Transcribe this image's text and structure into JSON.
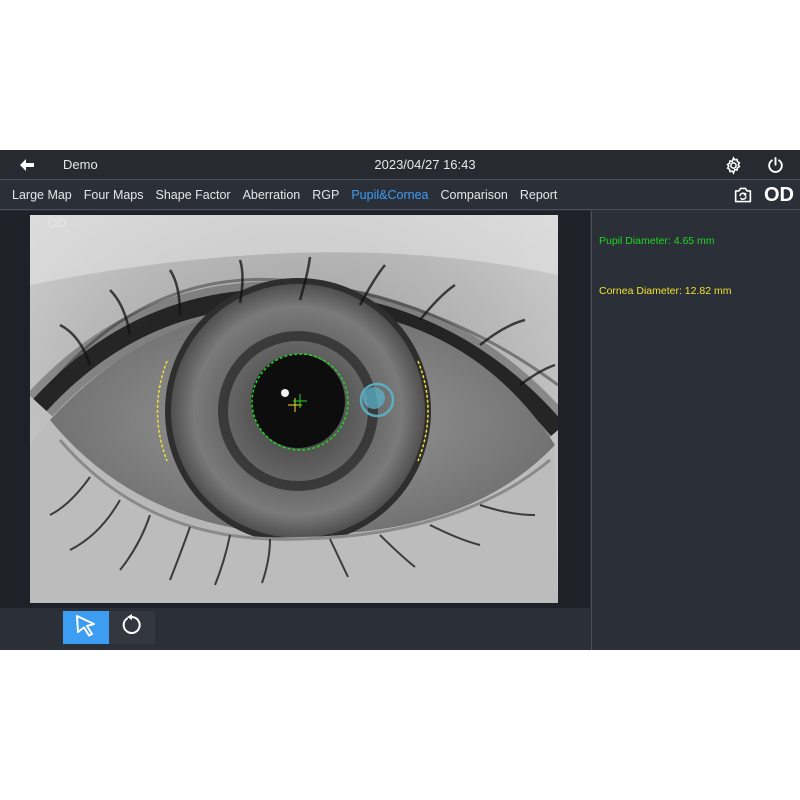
{
  "header": {
    "back_icon": "back-arrow-icon",
    "user_name": "Demo",
    "datetime": "2023/04/27 16:43",
    "settings_icon": "gear-icon",
    "power_icon": "power-icon"
  },
  "tabs": [
    {
      "label": "Large Map",
      "active": false
    },
    {
      "label": "Four Maps",
      "active": false
    },
    {
      "label": "Shape Factor",
      "active": false
    },
    {
      "label": "Aberration",
      "active": false
    },
    {
      "label": "RGP",
      "active": false
    },
    {
      "label": "Pupil&Cornea",
      "active": true
    },
    {
      "label": "Comparison",
      "active": false
    },
    {
      "label": "Report",
      "active": false
    }
  ],
  "tabbar": {
    "snapshot_icon": "camera-capture-icon",
    "eye_side": "OD"
  },
  "image": {
    "eye_label": "OD"
  },
  "results": {
    "pupil": "Pupil Diameter: 4.65 mm",
    "pupil_color": "#22d422",
    "cornea": "Cornea Diameter: 12.82 mm",
    "cornea_color": "#f0e130"
  },
  "toolbar": {
    "select_icon": "cursor-arrow-icon",
    "reset_icon": "rotate-reset-icon",
    "active_color": "#3d9df3"
  }
}
